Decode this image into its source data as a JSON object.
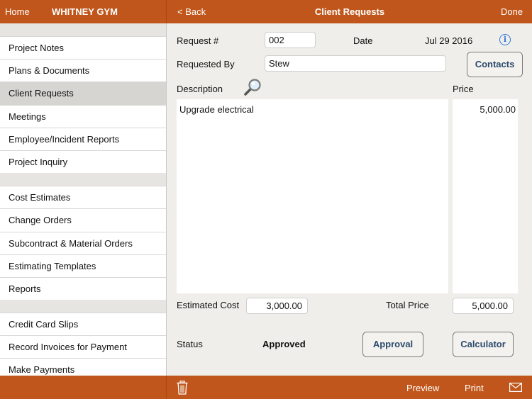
{
  "topbar": {
    "home_label": "Home",
    "project_name": "WHITNEY GYM",
    "back_label": "< Back",
    "title": "Client Requests",
    "done_label": "Done"
  },
  "sidebar": {
    "groups": [
      [
        "Project Notes",
        "Plans & Documents",
        "Client Requests",
        "Meetings",
        "Employee/Incident Reports",
        "Project Inquiry"
      ],
      [
        "Cost Estimates",
        "Change Orders",
        "Subcontract & Material Orders",
        "Estimating Templates",
        "Reports"
      ],
      [
        "Credit Card Slips",
        "Record Invoices for Payment",
        "Make Payments"
      ]
    ],
    "active_item": "Client Requests"
  },
  "form": {
    "request_label": "Request #",
    "request_value": "002",
    "date_label": "Date",
    "date_value": "Jul 29 2016",
    "info_icon": "info-icon",
    "requested_by_label": "Requested By",
    "requested_by_value": "Stew",
    "contacts_button": "Contacts",
    "description_label": "Description",
    "search_icon": "magnifier-icon",
    "price_label": "Price",
    "description_value": "Upgrade electrical",
    "price_value": "5,000.00",
    "estimated_cost_label": "Estimated Cost",
    "estimated_cost_value": "3,000.00",
    "total_price_label": "Total Price",
    "total_price_value": "5,000.00",
    "status_label": "Status",
    "status_value": "Approved",
    "approval_button": "Approval",
    "calculator_button": "Calculator"
  },
  "bottombar": {
    "trash_icon": "trash-icon",
    "preview_label": "Preview",
    "print_label": "Print",
    "mail_icon": "mail-icon"
  },
  "colors": {
    "bar": "#c0561b",
    "button_text": "#2c4a6c",
    "info": "#2f78d4"
  }
}
